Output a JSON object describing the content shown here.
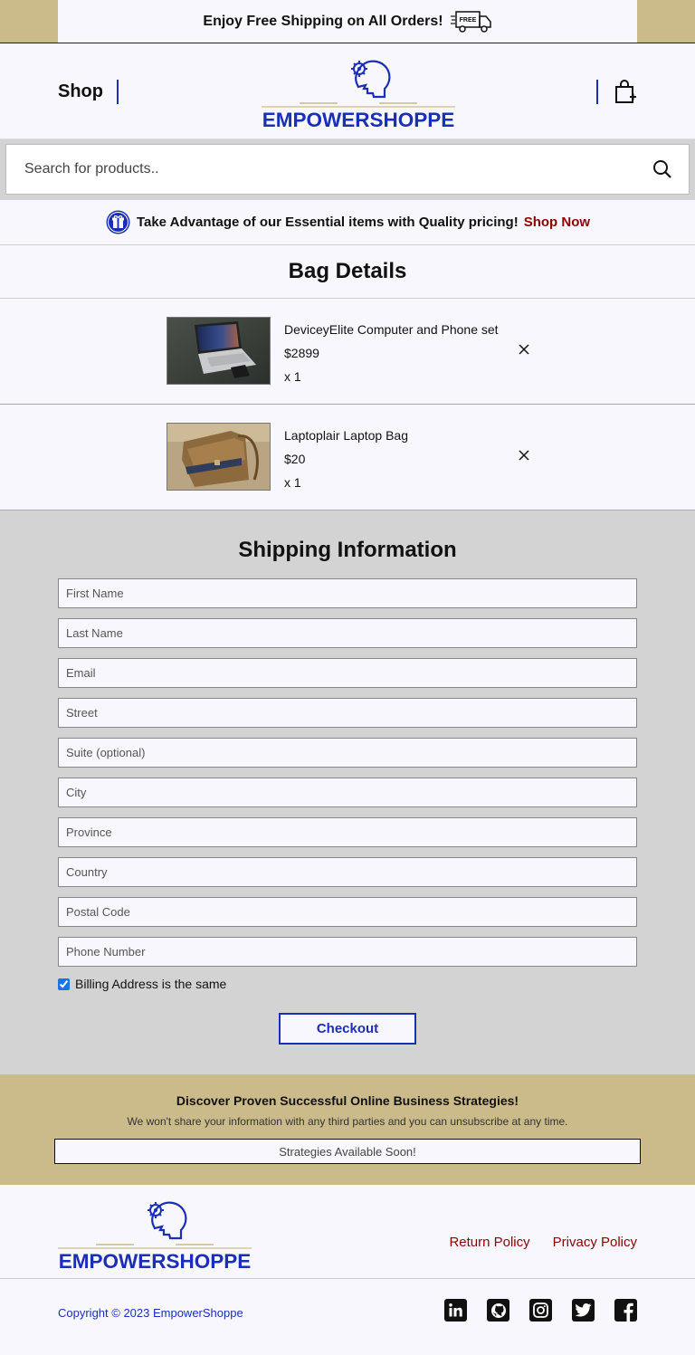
{
  "promo": {
    "text": "Enjoy Free Shipping on All Orders!",
    "badge": "FREE",
    "icon": "free-shipping-truck-icon"
  },
  "header": {
    "shop_label": "Shop",
    "logo_text": "EMPOWERSHOPPE",
    "cart_icon": "shopping-bag-icon"
  },
  "search": {
    "placeholder": "Search for products..",
    "icon": "search-icon"
  },
  "announcement": {
    "text": "Take Advantage of our Essential items with Quality pricing!",
    "link": "Shop Now",
    "icon": "gift-icon"
  },
  "bag": {
    "title": "Bag Details",
    "items": [
      {
        "name": "DeviceyElite Computer and Phone set",
        "price": "$2899",
        "qty": "x 1"
      },
      {
        "name": "Laptoplair Laptop Bag",
        "price": "$20",
        "qty": "x 1"
      }
    ]
  },
  "shipping": {
    "title": "Shipping Information",
    "fields": [
      "First Name",
      "Last Name",
      "Email",
      "Street",
      "Suite (optional)",
      "City",
      "Province",
      "Country",
      "Postal Code",
      "Phone Number"
    ],
    "billing_same_label": "Billing Address is the same",
    "billing_same_checked": true,
    "checkout_label": "Checkout"
  },
  "newsletter": {
    "title": "Discover Proven Successful Online Business Strategies!",
    "subtitle": "We won't share your information with any third parties and you can unsubscribe at any time.",
    "button": "Strategies Available Soon!"
  },
  "footer": {
    "logo_text": "EMPOWERSHOPPE",
    "links": [
      "Return Policy",
      "Privacy Policy"
    ],
    "copyright": "Copyright © 2023 EmpowerShoppe",
    "socials": [
      "linkedin-icon",
      "github-icon",
      "instagram-icon",
      "twitter-icon",
      "facebook-icon"
    ]
  },
  "colors": {
    "accent": "#1a2fb8",
    "gold": "#cbbb8a",
    "link_red": "#8b0000",
    "panel_gray": "#d3d3d3"
  }
}
